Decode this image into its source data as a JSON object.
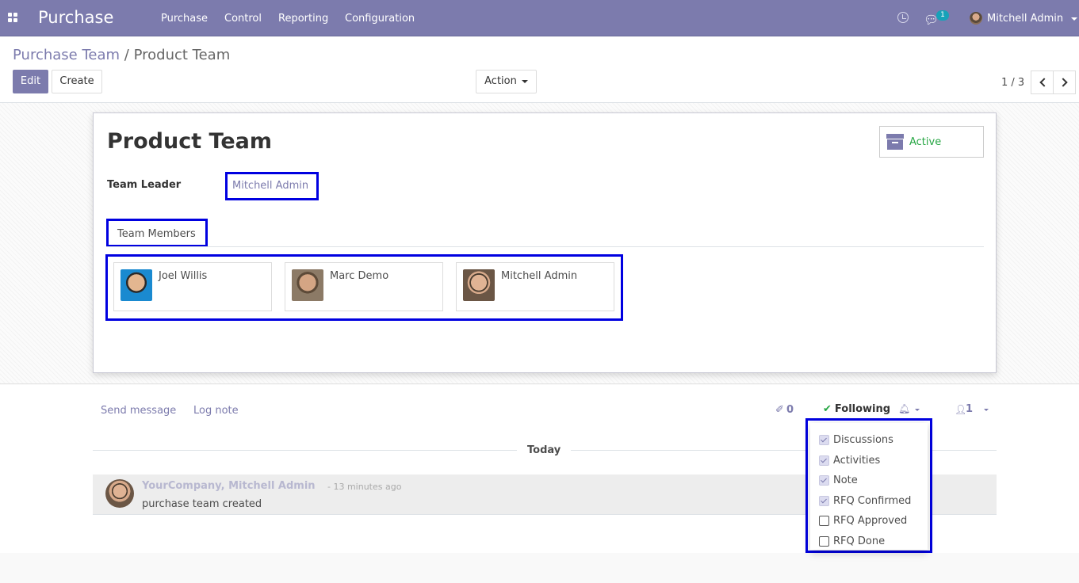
{
  "navbar": {
    "app_name": "Purchase",
    "menu": [
      "Purchase",
      "Control",
      "Reporting",
      "Configuration"
    ],
    "chat_badge": "1",
    "user_name": "Mitchell Admin",
    "icons": {
      "apps": "apps-grid-icon",
      "activity": "clock-icon",
      "messaging": "chat-icon"
    }
  },
  "breadcrumb": {
    "parent": "Purchase Team",
    "separator": "/",
    "current": "Product Team"
  },
  "buttons": {
    "edit": "Edit",
    "create": "Create",
    "action": "Action"
  },
  "pager": {
    "text": "1 / 3"
  },
  "form": {
    "title": "Product Team",
    "status_button": "Active",
    "team_leader_label": "Team Leader",
    "team_leader_value": "Mitchell Admin",
    "tab_label": "Team Members",
    "members": [
      {
        "name": "Joel Willis"
      },
      {
        "name": "Marc Demo"
      },
      {
        "name": "Mitchell Admin"
      }
    ]
  },
  "chatter": {
    "send_message": "Send message",
    "log_note": "Log note",
    "attachment_count": "0",
    "following_label": "Following",
    "follower_count": "1",
    "date_separator": "Today",
    "message": {
      "author": "YourCompany, Mitchell Admin",
      "time": "- 13 minutes ago",
      "body": "purchase team created"
    }
  },
  "subtypes_dropdown": [
    {
      "label": "Discussions",
      "checked": true
    },
    {
      "label": "Activities",
      "checked": true
    },
    {
      "label": "Note",
      "checked": true
    },
    {
      "label": "RFQ Confirmed",
      "checked": true
    },
    {
      "label": "RFQ Approved",
      "checked": false
    },
    {
      "label": "RFQ Done",
      "checked": false
    }
  ],
  "colors": {
    "brand": "#7c7bad",
    "active": "#28a745",
    "highlight_border": "#0000e0"
  }
}
